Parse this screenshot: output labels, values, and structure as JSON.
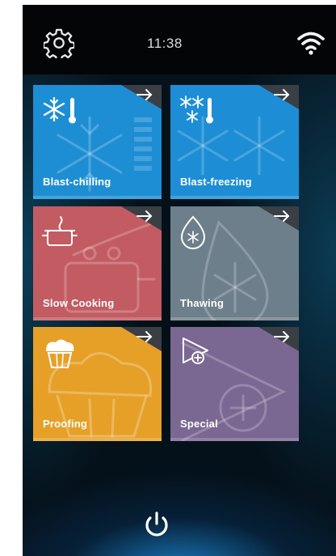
{
  "status_bar": {
    "time": "11:38",
    "settings_icon": "gear-icon",
    "wifi_icon": "wifi-icon"
  },
  "tiles": [
    {
      "label": "Blast-chilling",
      "icon": "snowflake-thermometer-icon",
      "color": "#1e8ed4"
    },
    {
      "label": "Blast-freezing",
      "icon": "snowflakes-thermometer-icon",
      "color": "#1d8ed5"
    },
    {
      "label": "Slow Cooking",
      "icon": "cooking-pot-icon",
      "color": "#c25c62"
    },
    {
      "label": "Thawing",
      "icon": "water-drop-snowflake-icon",
      "color": "#6e7f8c"
    },
    {
      "label": "Proofing",
      "icon": "muffin-icon",
      "color": "#e6a028"
    },
    {
      "label": "Special",
      "icon": "play-plus-icon",
      "color": "#7a6792"
    }
  ],
  "footer": {
    "power_icon": "power-icon"
  }
}
